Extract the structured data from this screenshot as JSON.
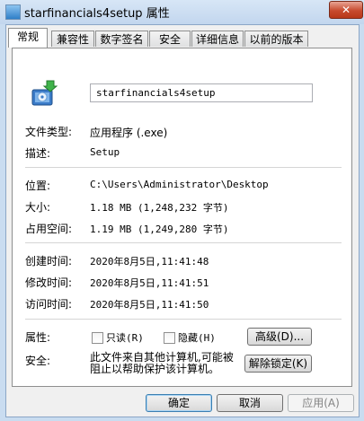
{
  "window": {
    "title": "starfinancials4setup 属性",
    "close_label": "✕"
  },
  "tabs": [
    "常规",
    "兼容性",
    "数字签名",
    "安全",
    "详细信息",
    "以前的版本"
  ],
  "general": {
    "file_name": "starfinancials4setup",
    "file_type_label": "文件类型:",
    "file_type_value": "应用程序 (.exe)",
    "description_label": "描述:",
    "description_value": "Setup",
    "location_label": "位置:",
    "location_value": "C:\\Users\\Administrator\\Desktop",
    "size_label": "大小:",
    "size_value": "1.18 MB (1,248,232 字节)",
    "size_on_disk_label": "占用空间:",
    "size_on_disk_value": "1.19 MB (1,249,280 字节)",
    "created_label": "创建时间:",
    "created_value": "2020年8月5日,11:41:48",
    "modified_label": "修改时间:",
    "modified_value": "2020年8月5日,11:41:51",
    "accessed_label": "访问时间:",
    "accessed_value": "2020年8月5日,11:41:50",
    "attributes_label": "属性:",
    "readonly_label": "只读(R)",
    "hidden_label": "隐藏(H)",
    "advanced_button": "高级(D)...",
    "security_label": "安全:",
    "security_text": "此文件来自其他计算机,可能被阻止以帮助保护该计算机。",
    "unblock_button": "解除锁定(K)"
  },
  "footer": {
    "ok": "确定",
    "cancel": "取消",
    "apply": "应用(A)"
  },
  "icons": {
    "title": "exe-file-icon",
    "app": "installer-icon"
  }
}
